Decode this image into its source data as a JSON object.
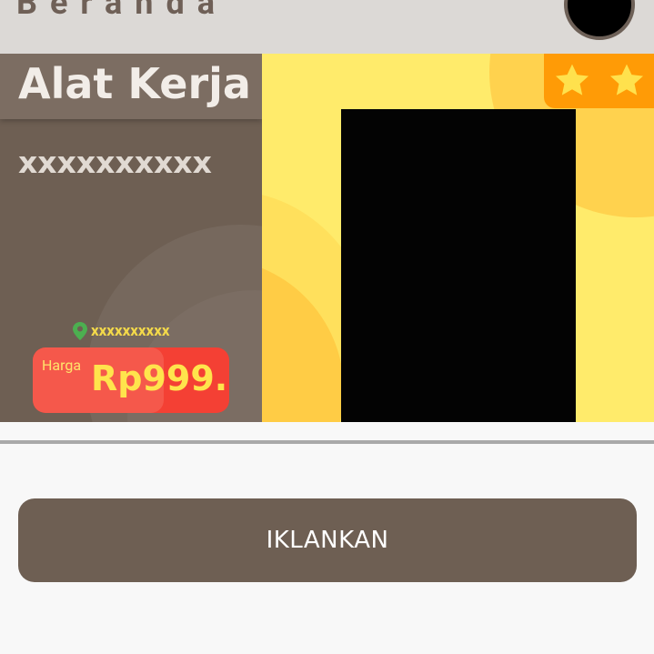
{
  "header": {
    "title": "Beranda",
    "avatar_icon": "user-avatar"
  },
  "card": {
    "category": "Alat Kerja",
    "product_name": "xxxxxxxxxx",
    "location_icon": "location-pin-icon",
    "location": "xxxxxxxxxx",
    "price_label": "Harga",
    "price_value": "Rp999...",
    "rating_stars": 2,
    "star_icon": "star-icon",
    "colors": {
      "left_panel": "#6e5f53",
      "right_panel": "#ffeb6b",
      "price_badge": "#f44034",
      "stars_badge": "#ff9b06",
      "price_text": "#ffe44c"
    }
  },
  "action": {
    "promote_label": "IKLANKAN",
    "button_color": "#6e5f53"
  }
}
